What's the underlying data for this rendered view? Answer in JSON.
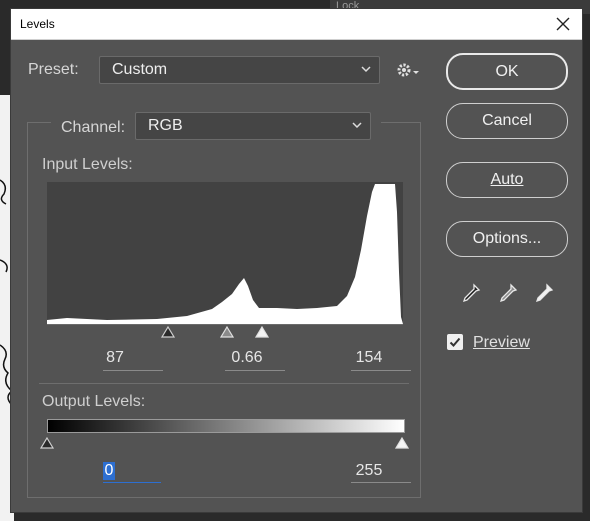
{
  "window": {
    "title": "Levels"
  },
  "preset": {
    "label": "Preset:",
    "value": "Custom"
  },
  "channel": {
    "label": "Channel:",
    "value": "RGB"
  },
  "input_levels": {
    "label": "Input Levels:",
    "black": "87",
    "gamma": "0.66",
    "white": "154"
  },
  "output_levels": {
    "label": "Output Levels:",
    "black": "0",
    "white": "255"
  },
  "buttons": {
    "ok": "OK",
    "cancel": "Cancel",
    "auto": "Auto",
    "options": "Options..."
  },
  "preview": {
    "label": "Preview",
    "checked": true
  },
  "background_hint": {
    "locks_label": "Lock"
  },
  "icons": {
    "close": "close-icon",
    "gear": "gear-icon",
    "eyedroppers": [
      "black-eyedropper-icon",
      "gray-eyedropper-icon",
      "white-eyedropper-icon"
    ]
  }
}
